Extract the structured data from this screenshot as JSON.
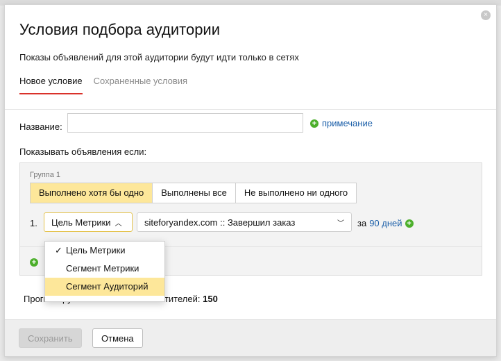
{
  "dialog": {
    "title": "Условия подбора аудитории",
    "subtitle": "Показы объявлений для этой аудитории будут идти только в сетях",
    "close_icon": "close-icon"
  },
  "tabs": [
    {
      "label": "Новое условие",
      "active": true
    },
    {
      "label": "Сохраненные условия",
      "active": false
    }
  ],
  "form": {
    "name_label": "Название:",
    "name_value": "",
    "note_link": "примечание",
    "show_label": "Показывать объявления если:"
  },
  "group": {
    "title": "Группа 1",
    "modes": [
      {
        "label": "Выполнено хотя бы одно",
        "selected": true
      },
      {
        "label": "Выполнены все",
        "selected": false
      },
      {
        "label": "Не выполнено ни одного",
        "selected": false
      }
    ],
    "condition": {
      "number": "1.",
      "type_value": "Цель Метрики",
      "goal_value": "siteforyandex.com :: Завершил заказ",
      "period_prefix": "за",
      "period_value": "90 дней"
    }
  },
  "dropdown": {
    "options": [
      {
        "label": "Цель Метрики",
        "checked": true,
        "highlighted": false
      },
      {
        "label": "Сегмент Метрики",
        "checked": false,
        "highlighted": false
      },
      {
        "label": "Сегмент Аудиторий",
        "checked": false,
        "highlighted": true
      }
    ]
  },
  "count": {
    "label": "Прогнозируемое количество посетителей:",
    "value": "150"
  },
  "footer": {
    "save_label": "Сохранить",
    "cancel_label": "Отмена"
  },
  "colors": {
    "accent_tab": "#d9312a",
    "selected_fill": "#fde79a",
    "link": "#1a5ea8",
    "plus_green": "#4caf2b"
  }
}
